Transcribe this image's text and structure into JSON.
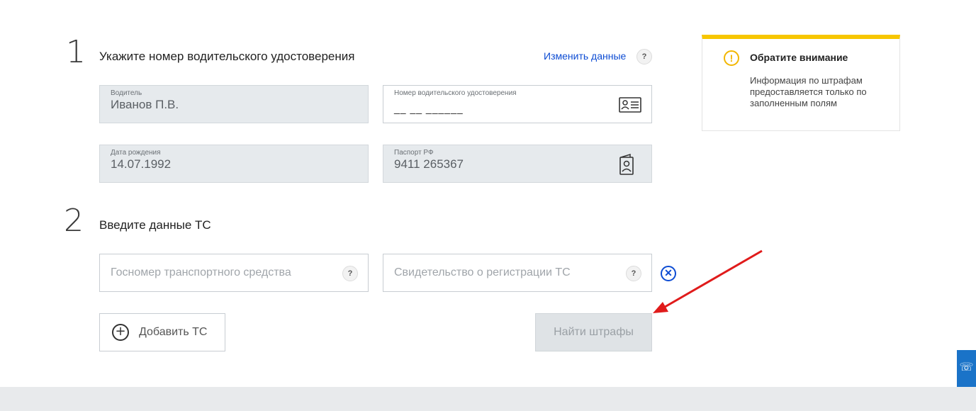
{
  "step1": {
    "number": "1",
    "title": "Укажите номер водительского удостоверения",
    "change_link": "Изменить данные",
    "help": "?"
  },
  "fields": {
    "driver": {
      "label": "Водитель",
      "value": "Иванов П.В."
    },
    "license": {
      "label": "Номер водительского удостоверения",
      "value": "__ __ ______",
      "icon": "license-card-icon"
    },
    "birth": {
      "label": "Дата рождения",
      "value": "14.07.1992"
    },
    "passport": {
      "label": "Паспорт РФ",
      "value": "9411 265367",
      "icon": "passport-icon"
    }
  },
  "step2": {
    "number": "2",
    "title": "Введите данные ТС",
    "plate_placeholder": "Госномер транспортного средства",
    "registration_placeholder": "Свидетельство о регистрации ТС",
    "help": "?"
  },
  "buttons": {
    "add_vehicle": "Добавить ТС",
    "find_fines": "Найти штрафы",
    "remove_icon": "close-circle-icon"
  },
  "notice": {
    "title": "Обратите внимание",
    "text": "Информация по штрафам предоставляется только по заполненным полям",
    "icon": "warning-icon",
    "accent": "#f7c600"
  },
  "colors": {
    "link": "#0d4cd3",
    "filled_field": "#e6eaed",
    "arrow": "#e01b1b",
    "side_widget": "#1a73c8"
  }
}
